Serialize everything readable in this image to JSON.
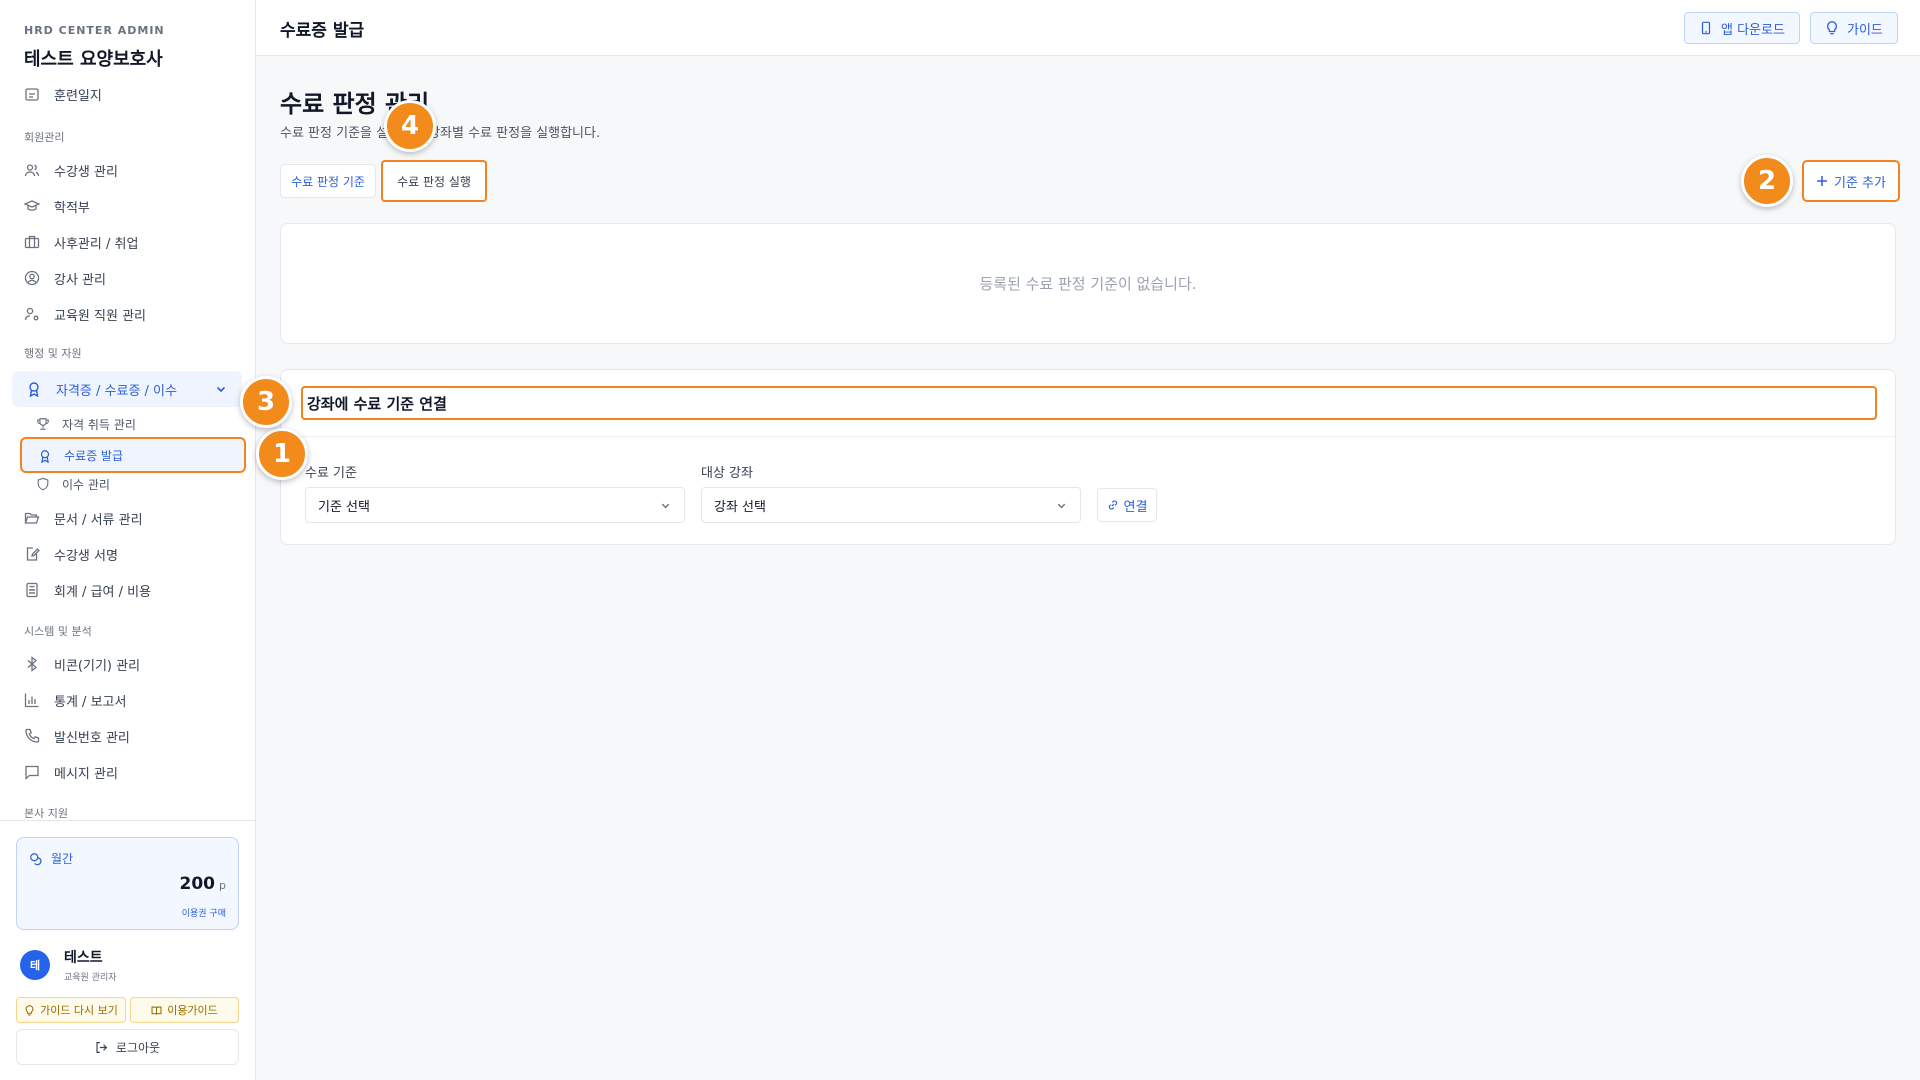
{
  "brand": {
    "subtitle": "HRD CENTER ADMIN",
    "title": "테스트 요양보호사"
  },
  "sidebar": {
    "partial_item": "훈련일지",
    "groups": {
      "members": "회원관리",
      "admin": "행정 및 자원",
      "system": "시스템 및 분석",
      "hq": "본사 지원"
    },
    "member_items": [
      "수강생 관리",
      "학적부",
      "사후관리 / 취업",
      "강사 관리",
      "교육원 직원 관리"
    ],
    "admin_parent": "자격증 / 수료증 / 이수",
    "admin_subitems": [
      "자격 취득 관리",
      "수료증 발급",
      "이수 관리"
    ],
    "admin_items": [
      "문서 / 서류 관리",
      "수강생 서명",
      "회계 / 급여 / 비용"
    ],
    "system_items": [
      "비콘(기기) 관리",
      "통계 / 보고서",
      "발신번호 관리",
      "메시지 관리"
    ]
  },
  "points": {
    "label": "월간",
    "value": "200",
    "unit": "p",
    "buy_label": "이용권 구매"
  },
  "user": {
    "avatar": "테",
    "name": "테스트",
    "role": "교육원 관리자"
  },
  "footer_buttons": {
    "guide_again": "가이드 다시 보기",
    "usage_guide": "이용가이드",
    "logout": "로그아웃"
  },
  "header": {
    "title": "수료증 발급",
    "app_download": "앱 다운로드",
    "guide": "가이드"
  },
  "main": {
    "title": "수료 판정 관리",
    "description": "수료 판정 기준을 설정하고 강좌별 수료 판정을 실행합니다.",
    "tabs": [
      "수료 판정 기준",
      "수료 판정 실행"
    ],
    "add_button": "기준 추가",
    "empty_message": "등록된 수료 판정 기준이 없습니다.",
    "link_section": {
      "title": "강좌에 수료 기준 연결",
      "criteria_label": "수료 기준",
      "criteria_placeholder": "기준 선택",
      "course_label": "대상 강좌",
      "course_placeholder": "강좌 선택",
      "link_button": "연결"
    }
  },
  "callouts": [
    "1",
    "2",
    "3",
    "4"
  ],
  "colors": {
    "accent": "#2b5fd9",
    "highlight": "#f58220",
    "callout": "#f28a1c"
  }
}
